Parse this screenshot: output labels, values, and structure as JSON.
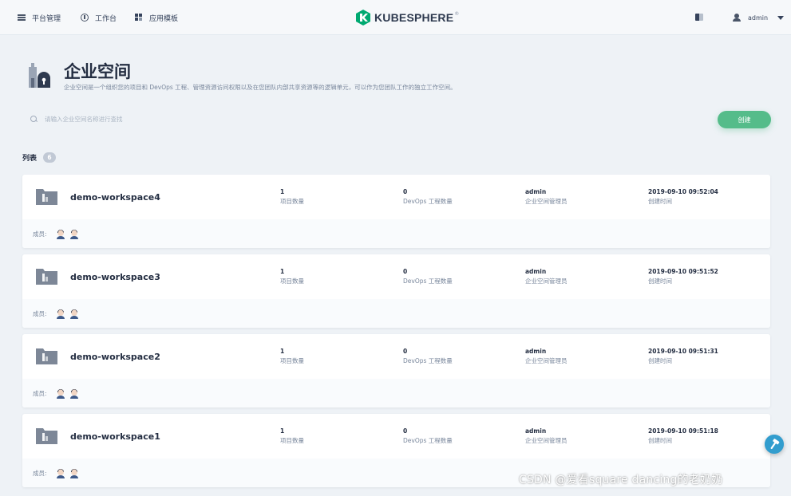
{
  "nav": {
    "items": [
      {
        "label": "平台管理",
        "icon": "platform-icon"
      },
      {
        "label": "工作台",
        "icon": "workbench-icon"
      },
      {
        "label": "应用模板",
        "icon": "app-templates-icon"
      }
    ],
    "brand": "KUBESPHERE",
    "brand_mark": "®",
    "user": "admin"
  },
  "header": {
    "title": "企业空间",
    "description": "企业空间是一个组织您的项目和 DevOps 工程、管理资源访问权限以及在您团队内部共享资源等的逻辑单元，可以作为您团队工作的独立工作空间。"
  },
  "search": {
    "placeholder": "请输入企业空间名称进行查找",
    "value": ""
  },
  "create_button": "创建",
  "list": {
    "label": "列表",
    "count": "6",
    "members_label": "成员:",
    "stat_labels": {
      "projects": "项目数量",
      "devops": "DevOps 工程数量",
      "manager": "企业空间管理员",
      "created": "创建时间"
    },
    "workspaces": [
      {
        "name": "demo-workspace4",
        "projects": "1",
        "devops": "0",
        "manager": "admin",
        "created": "2019-09-10 09:52:04"
      },
      {
        "name": "demo-workspace3",
        "projects": "1",
        "devops": "0",
        "manager": "admin",
        "created": "2019-09-10 09:51:52"
      },
      {
        "name": "demo-workspace2",
        "projects": "1",
        "devops": "0",
        "manager": "admin",
        "created": "2019-09-10 09:51:31"
      },
      {
        "name": "demo-workspace1",
        "projects": "1",
        "devops": "0",
        "manager": "admin",
        "created": "2019-09-10 09:51:18"
      }
    ]
  },
  "watermark": "CSDN @爱看square dancing的老奶奶",
  "colors": {
    "accent": "#55bc8a",
    "brand": "#00a971",
    "text": "#242e42",
    "help": "#329dce"
  }
}
